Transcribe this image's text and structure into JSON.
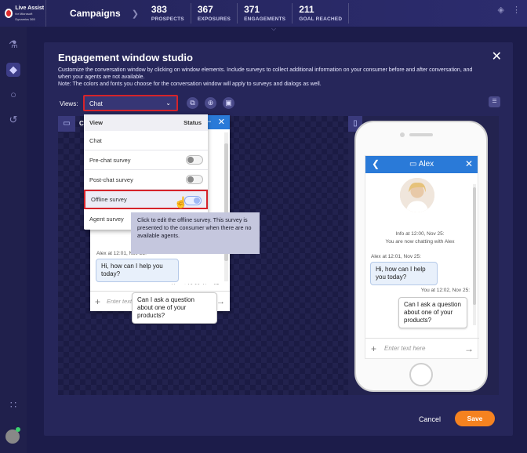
{
  "topbar": {
    "logo_line1": "Live Assist",
    "logo_line2": "for Microsoft Dynamics 365",
    "campaigns": "Campaigns",
    "stats": [
      {
        "num": "383",
        "label": "PROSPECTS"
      },
      {
        "num": "367",
        "label": "EXPOSURES"
      },
      {
        "num": "371",
        "label": "ENGAGEMENTS"
      },
      {
        "num": "211",
        "label": "GOAL REACHED"
      }
    ]
  },
  "studio": {
    "title": "Engagement window studio",
    "desc1": "Customize the conversation window by clicking on window elements. Include surveys to collect additional information on your consumer before and after conversation, and when your agents are not available.",
    "desc2": "Note: The colors and fonts you choose for the conversation window will apply to surveys and dialogs as well.",
    "views_label": "Views:",
    "views_value": "Chat",
    "canvas_label": "C"
  },
  "dropdown": {
    "col_view": "View",
    "col_status": "Status",
    "items": [
      {
        "label": "Chat"
      },
      {
        "label": "Pre-chat survey",
        "status": "off"
      },
      {
        "label": "Post-chat survey",
        "status": "off"
      },
      {
        "label": "Offline survey",
        "status": "on"
      },
      {
        "label": "Agent survey"
      }
    ]
  },
  "tooltip": "Click to edit the offline survey. This survey is presented to the consumer when there are no available agents.",
  "chat": {
    "agent_name": "Alex",
    "info_line1": "Info at 12:00, Nov 25:",
    "info_line2": "You are now chatting with Alex",
    "agent_meta": "Alex at 12:01, Nov 25:",
    "agent_msg": "Hi, how can I help you today?",
    "user_meta": "You at 12:02, Nov 25:",
    "user_msg": "Can I ask a question about one of your products?",
    "input_placeholder": "Enter text here"
  },
  "footer": {
    "cancel": "Cancel",
    "save": "Save"
  },
  "colors": {
    "accent": "#2a7ad8",
    "save": "#f58220",
    "highlight": "#d6232a"
  }
}
